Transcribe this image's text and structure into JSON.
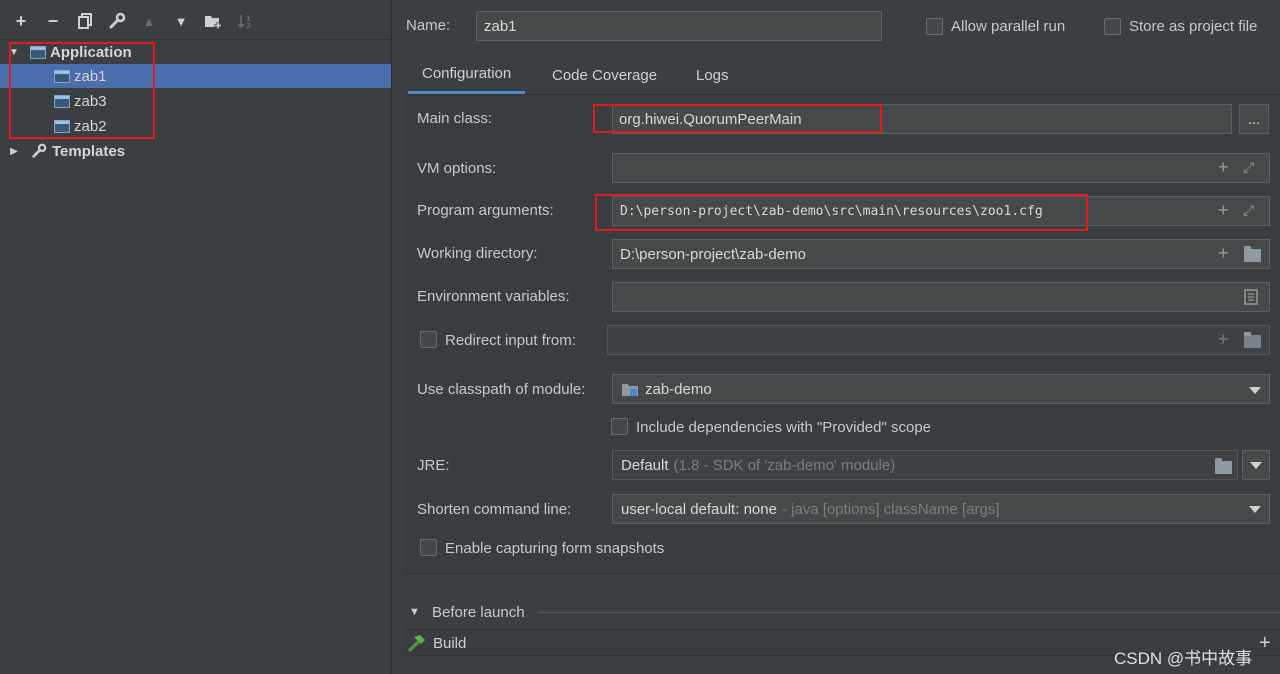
{
  "tree": {
    "application": {
      "label": "Application"
    },
    "configs": [
      {
        "label": "zab1",
        "selected": true
      },
      {
        "label": "zab3",
        "selected": false
      },
      {
        "label": "zab2",
        "selected": false
      }
    ],
    "templates": {
      "label": "Templates"
    }
  },
  "header": {
    "name_label": "Name:",
    "name_value": "zab1",
    "allow_parallel_label": "Allow parallel run",
    "store_project_label": "Store as project file"
  },
  "tabs": [
    {
      "label": "Configuration",
      "active": true
    },
    {
      "label": "Code Coverage",
      "active": false
    },
    {
      "label": "Logs",
      "active": false
    }
  ],
  "form": {
    "main_class": {
      "label": "Main class:",
      "value": "org.hiwei.QuorumPeerMain",
      "browse": "..."
    },
    "vm_options": {
      "label": "VM options:",
      "value": ""
    },
    "program_args": {
      "label": "Program arguments:",
      "value": "D:\\person-project\\zab-demo\\src\\main\\resources\\zoo1.cfg"
    },
    "working_dir": {
      "label": "Working directory:",
      "value": "D:\\person-project\\zab-demo"
    },
    "env_vars": {
      "label": "Environment variables:",
      "value": ""
    },
    "redirect_input": {
      "label": "Redirect input from:",
      "value": ""
    },
    "classpath_module": {
      "label": "Use classpath of module:",
      "value": "zab-demo"
    },
    "include_provided": {
      "label": "Include dependencies with \"Provided\" scope"
    },
    "jre": {
      "label": "JRE:",
      "value": "Default",
      "hint": "(1.8 - SDK of 'zab-demo' module)"
    },
    "shorten_cmd": {
      "label": "Shorten command line:",
      "value": "user-local default: none",
      "hint": "- java [options] className [args]"
    },
    "form_snapshots": {
      "label": "Enable capturing form snapshots"
    }
  },
  "before_launch": {
    "label": "Before launch",
    "items": [
      {
        "label": "Build"
      }
    ]
  },
  "watermark": "CSDN @书中故事",
  "colors": {
    "background": "#3c3f41",
    "selection": "#4b6eaf",
    "highlight_box": "#e01b1b",
    "tab_underline": "#4a88c7"
  }
}
